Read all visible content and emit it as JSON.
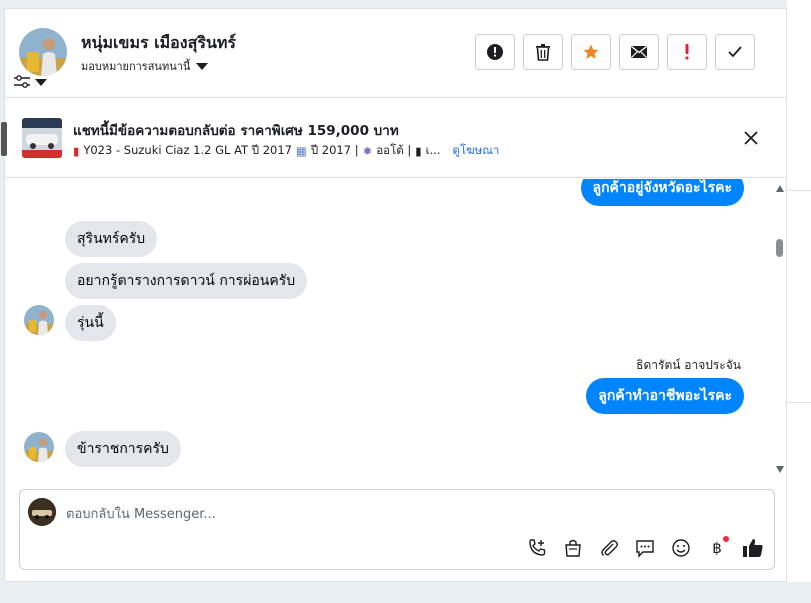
{
  "header": {
    "contact_name": "หนุ่มเขมร เมืองสุรินทร์",
    "assignment_label": "มอบหมายการสนทนานี้",
    "actions": [
      {
        "name": "report-spam-button",
        "icon": "exclamation-circle-icon"
      },
      {
        "name": "delete-button",
        "icon": "trash-icon"
      },
      {
        "name": "star-button",
        "icon": "star-icon"
      },
      {
        "name": "mark-unread-button",
        "icon": "envelope-icon"
      },
      {
        "name": "follow-up-button",
        "icon": "exclamation-icon"
      },
      {
        "name": "mark-done-button",
        "icon": "check-icon"
      }
    ]
  },
  "ad": {
    "title": "แชทนี้มีข้อความตอบกลับต่อ ราคาพิเศษ 159,000 บาท",
    "details_part1": "Y023 - Suzuki Ciaz 1.2 GL AT ปี 2017",
    "details_part2": "ปี 2017 |",
    "details_part3": "ออโต้ |",
    "details_part4": "เ...",
    "link": "ดูโฆษณา"
  },
  "thread": {
    "msg_out_1": "ลูกค้าอยู่จังหวัดอะไรคะ",
    "msg_in_1": "สุรินทร์ครับ",
    "msg_in_2": "อยากรู้ตารางการดาวน์ การผ่อนครับ",
    "msg_in_3": "รุ่นนี้",
    "sender_name": "ธิดารัตน์ อาจประจัน",
    "msg_out_2": "ลูกค้าทำอาชีพอะไรคะ",
    "msg_in_4": "ข้าราชการครับ"
  },
  "composer": {
    "placeholder": "ตอบกลับใน Messenger...",
    "tools": [
      "phone-plus-icon",
      "shopping-bag-icon",
      "paperclip-icon",
      "chat-bubble-icon",
      "emoji-icon",
      "baht-icon",
      "thumbs-up-icon"
    ],
    "baht_symbol": "฿"
  },
  "colors": {
    "outgoing_bubble": "#0084ff",
    "incoming_bubble": "#e4e6eb",
    "link": "#216fdb",
    "star": "#f5821f",
    "alert": "#e41e3f"
  }
}
